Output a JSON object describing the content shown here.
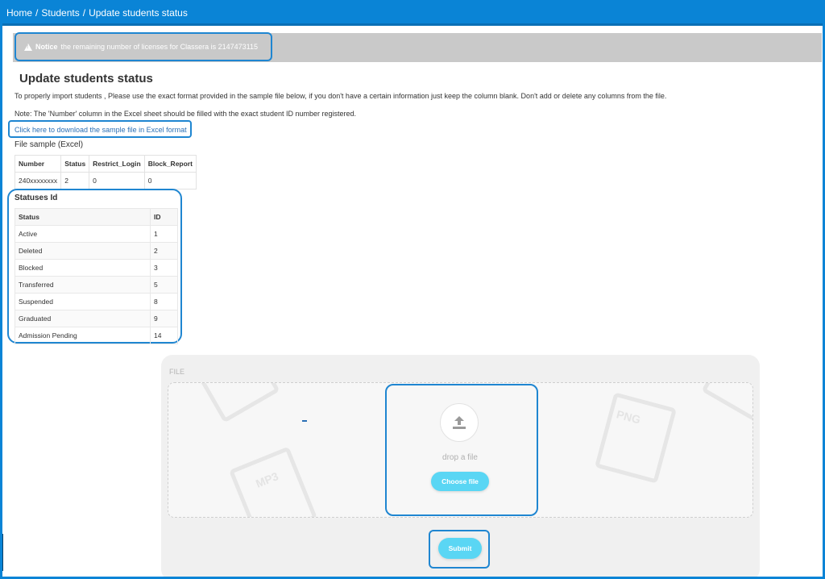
{
  "breadcrumb": {
    "home": "Home",
    "separator": "/",
    "students": "Students",
    "current": "Update students status"
  },
  "notice": {
    "label": "Notice",
    "text": "the remaining number of licenses for Classera is 2147473115"
  },
  "page": {
    "title": "Update students status",
    "instructions": "To properly import students , Please use the exact format provided in the sample file below, if you don't have a certain information just keep the column blank. Don't add or delete any columns from the file.",
    "note": "Note: The 'Number' column in the Excel sheet should be filled with the exact student ID number registered.",
    "download_link": "Click here to download the sample file in Excel format"
  },
  "sample": {
    "heading": "File sample (Excel)",
    "columns": [
      "Number",
      "Status",
      "Restrict_Login",
      "Block_Report"
    ],
    "rows": [
      [
        "240xxxxxxxx",
        "2",
        "0",
        "0"
      ]
    ]
  },
  "statuses": {
    "heading": "Statuses Id",
    "columns": [
      "Status",
      "ID"
    ],
    "rows": [
      [
        "Active",
        "1"
      ],
      [
        "Deleted",
        "2"
      ],
      [
        "Blocked",
        "3"
      ],
      [
        "Transferred",
        "5"
      ],
      [
        "Suspended",
        "8"
      ],
      [
        "Graduated",
        "9"
      ],
      [
        "Admission Pending",
        "14"
      ]
    ]
  },
  "upload": {
    "label": "FILE",
    "drop_text": "drop a file",
    "choose_button": "Choose file",
    "submit_button": "Submit",
    "bg_icons": [
      "MP3",
      "PNG"
    ]
  },
  "colors": {
    "topbar": "#0a84d6",
    "highlight": "#1f86d1",
    "button": "#5ad6f4",
    "notice_bg": "#c9c9c9"
  }
}
